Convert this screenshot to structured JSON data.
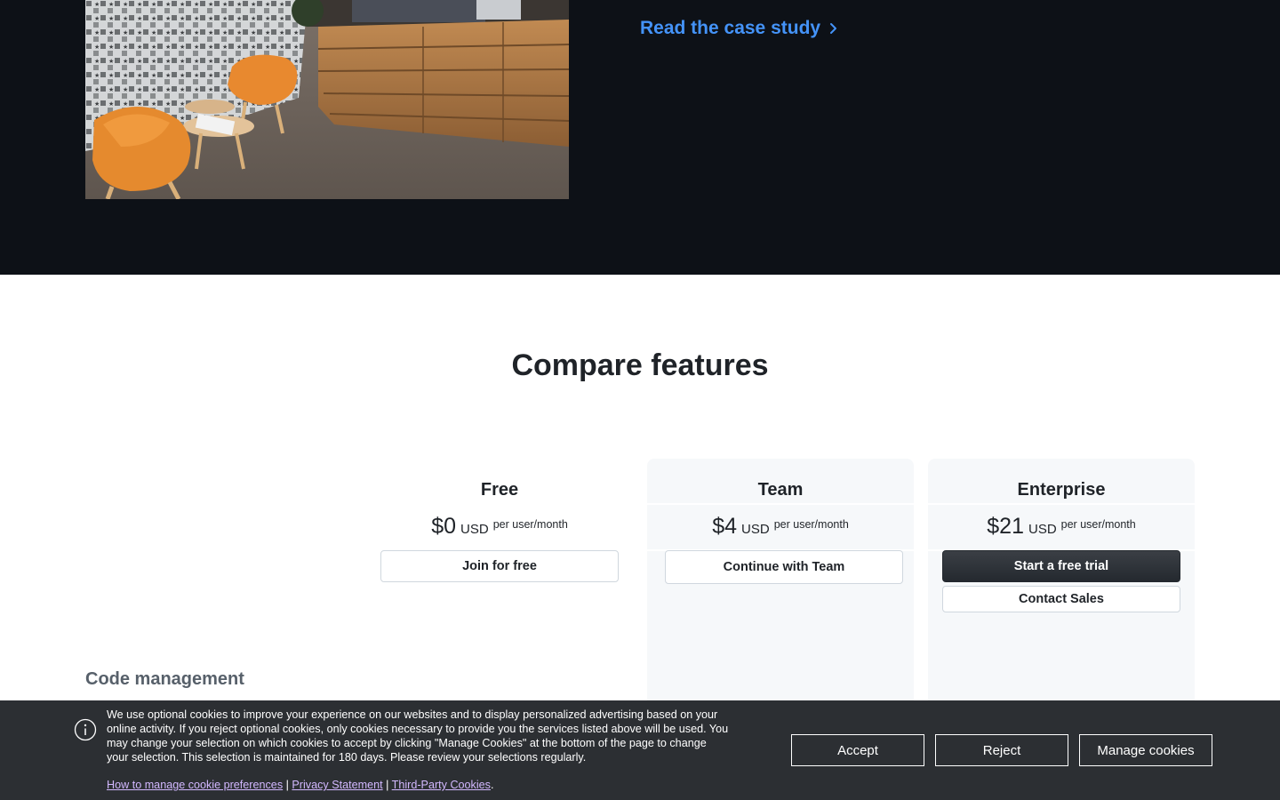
{
  "case_study": {
    "link_label": "Read the case study",
    "photo_alt": "Office lounge with orange chairs and wooden reception desk"
  },
  "compare": {
    "title": "Compare features",
    "plans": [
      {
        "name": "Free",
        "price": "$0",
        "currency": "USD",
        "period": "per user/month",
        "buttons": [
          "Join for free"
        ]
      },
      {
        "name": "Team",
        "price": "$4",
        "currency": "USD",
        "period": "per user/month",
        "buttons": [
          "Continue with Team"
        ]
      },
      {
        "name": "Enterprise",
        "price": "$21",
        "currency": "USD",
        "period": "per user/month",
        "buttons": [
          "Start a free trial",
          "Contact Sales"
        ]
      }
    ],
    "section_heading": "Code management"
  },
  "cookie_banner": {
    "text": "We use optional cookies to improve your experience on our websites and to display personalized advertising based on your online activity. If you reject optional cookies, only cookies necessary to provide you the services listed above will be used. You may change your selection on which cookies to accept by clicking \"Manage Cookies\" at the bottom of the page to change your selection. This selection is maintained for 180 days. Please review your selections regularly.",
    "links": [
      "How to manage cookie preferences",
      "Privacy Statement",
      "Third-Party Cookies"
    ],
    "separator": "|",
    "end_punct": ".",
    "buttons": {
      "accept": "Accept",
      "reject": "Reject",
      "manage": "Manage cookies"
    }
  },
  "colors": {
    "dark_bg": "#0d1117",
    "link_blue": "#4493f8",
    "banner_bg": "#2c2f33",
    "shaded_col": "#f6f8fa"
  },
  "icons": {
    "link_chevron": "chevron-right-icon",
    "banner_info": "info-icon"
  }
}
